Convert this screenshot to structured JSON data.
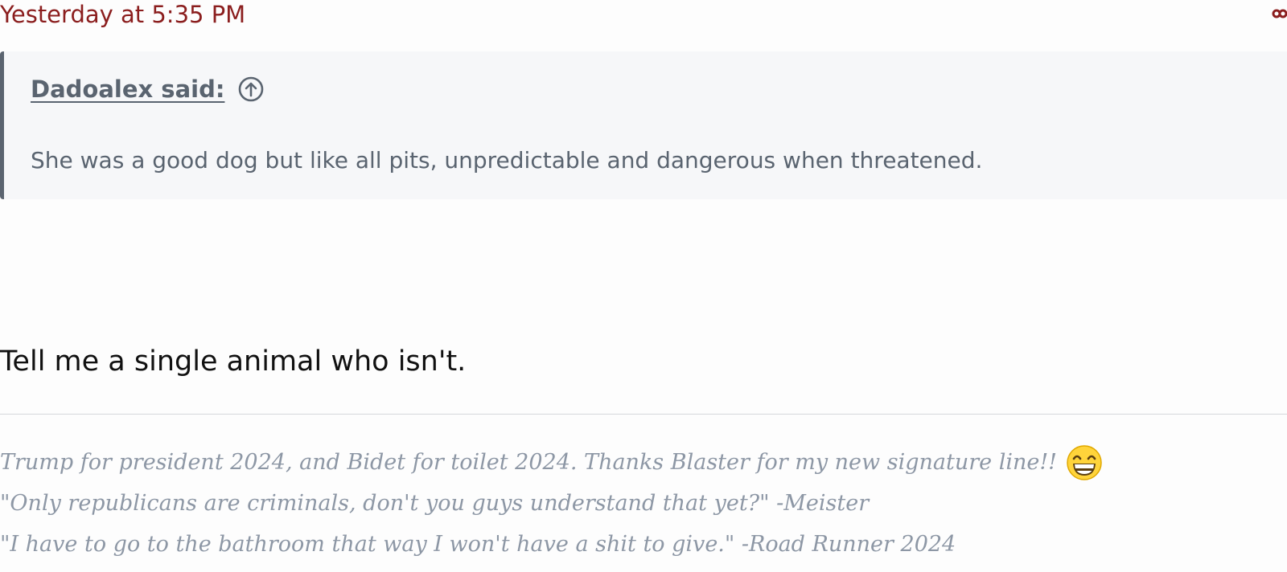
{
  "post": {
    "timestamp": "Yesterday at 5:35 PM",
    "reply_text": "Tell me a single animal who isn't."
  },
  "quote": {
    "author_label": "Dadoalex said:",
    "body": "She was a good dog but like all pits, unpredictable and dangerous when threatened."
  },
  "signature": {
    "lines": [
      "Trump for president 2024, and Bidet for toilet 2024. Thanks Blaster for my new signature line!!",
      "\"Only republicans are criminals, don't you guys understand that yet?\" -Meister",
      "\"I have to go to the bathroom that way I won't have a shit to give.\" -Road Runner 2024"
    ],
    "emoji": "grinning-face-emoji"
  },
  "icons": {
    "share": "share-icon",
    "goto": "arrow-up-circle-icon"
  },
  "colors": {
    "timestamp": "#8b1e1e",
    "quote_text": "#5a6470",
    "quote_border": "#5b6470",
    "quote_bg": "#f6f7f9",
    "reply_text": "#111111",
    "signature_text": "#8d97a5"
  }
}
